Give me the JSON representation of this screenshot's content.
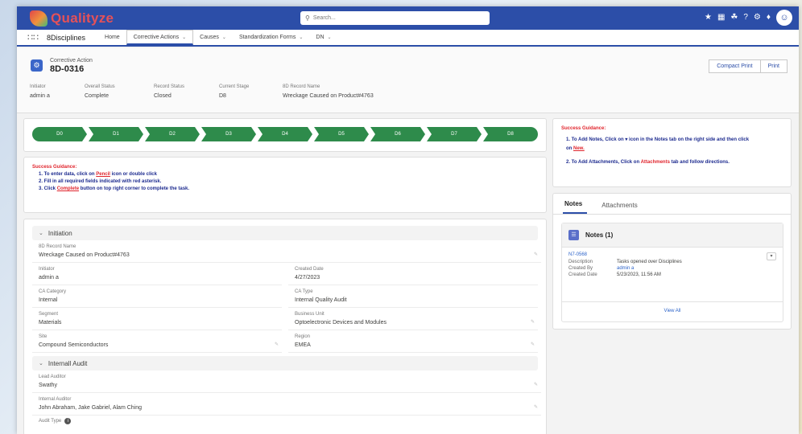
{
  "brand": {
    "name": "Qualityze"
  },
  "search": {
    "placeholder": "Search..."
  },
  "nav": {
    "app_name": "8Disciplines",
    "items": [
      {
        "label": "Home",
        "dropdown": false,
        "active": false
      },
      {
        "label": "Corrective Actions",
        "dropdown": true,
        "active": true
      },
      {
        "label": "Causes",
        "dropdown": true,
        "active": false
      },
      {
        "label": "Standardization Forms",
        "dropdown": true,
        "active": false
      },
      {
        "label": "DN",
        "dropdown": true,
        "active": false
      }
    ]
  },
  "record": {
    "type": "Corrective Action",
    "name": "8D-0316",
    "buttons": {
      "compact_print": "Compact Print",
      "print": "Print"
    },
    "highlights": [
      {
        "label": "Initiator",
        "value": "admin a"
      },
      {
        "label": "Overall Status",
        "value": "Complete"
      },
      {
        "label": "Record Status",
        "value": "Closed"
      },
      {
        "label": "Current Stage",
        "value": "D8"
      },
      {
        "label": "8D Record Name",
        "value": "Wreckage Caused on Product#4763"
      }
    ]
  },
  "path": {
    "steps": [
      "D0",
      "D1",
      "D2",
      "D3",
      "D4",
      "D5",
      "D6",
      "D7",
      "D8"
    ]
  },
  "left_guidance": {
    "title": "Success Guidance:",
    "lines": [
      {
        "pre": "1. To enter data, click on ",
        "hl": "Pencil",
        "post": " icon or double click"
      },
      {
        "pre": "2. Fill in all required fields indicated with red asterisk.",
        "hl": "",
        "post": ""
      },
      {
        "pre": "3. Click ",
        "hl": "Complete",
        "post": " button on top right corner to complete the task."
      }
    ]
  },
  "initiation": {
    "section_label": "Initiation",
    "record_name": {
      "label": "8D Record Name",
      "value": "Wreckage Caused on Product#4763"
    },
    "rows": [
      [
        {
          "label": "Initiator",
          "value": "admin a"
        },
        {
          "label": "Created Date",
          "value": "4/27/2023"
        }
      ],
      [
        {
          "label": "CA Category",
          "value": "Internal"
        },
        {
          "label": "CA Type",
          "value": "Internal Quality Audit"
        }
      ],
      [
        {
          "label": "Segment",
          "value": "Materials"
        },
        {
          "label": "Business Unit",
          "value": "Optoelectronic Devices and Modules"
        }
      ],
      [
        {
          "label": "Site",
          "value": "Compound Semiconductors"
        },
        {
          "label": "Region",
          "value": "EMEA"
        }
      ]
    ]
  },
  "internal_audit": {
    "section_label": "Internall Audit",
    "lead_auditor": {
      "label": "Lead Auditor",
      "value": "Swathy"
    },
    "internal_auditor": {
      "label": "Internal Auditor",
      "value": "John Abraham, Jake Gabriel, Alam Ching"
    },
    "audit_type_label": "Audit Type"
  },
  "right_guidance": {
    "title": "Success Guidance:",
    "line1_pre": "1. To Add Notes, Click on",
    "line1_post": " icon in the Notes tab on the right side and then click",
    "line1_cont_pre": "on ",
    "line1_cont_hl": "New.",
    "line2_pre": "2. To Add Attachments, Click on ",
    "line2_hl": "Attachments",
    "line2_post": " tab and follow directions."
  },
  "notes_panel": {
    "tabs": [
      "Notes",
      "Attachments"
    ],
    "header": "Notes (1)",
    "record_link": "N7-0568",
    "fields": [
      {
        "label": "Description",
        "value": "Tasks opened over Disciplines",
        "link": false
      },
      {
        "label": "Created By",
        "value": "admin a",
        "link": true
      },
      {
        "label": "Created Date",
        "value": "5/23/2023, 11:56 AM",
        "link": false
      }
    ],
    "view_all": "View All"
  },
  "icons": {
    "search": "search-icon",
    "waffle": "app-launcher-icon",
    "record": "record-icon",
    "chevron": "chevron-down-icon",
    "pencil": "pencil-icon",
    "notes": "notes-icon",
    "info": "info-icon"
  },
  "colors": {
    "brand_blue": "#2c4ea8",
    "path_green": "#2e8b4b",
    "guidance_red": "#e0252d",
    "guidance_blue": "#1d2b8f"
  }
}
